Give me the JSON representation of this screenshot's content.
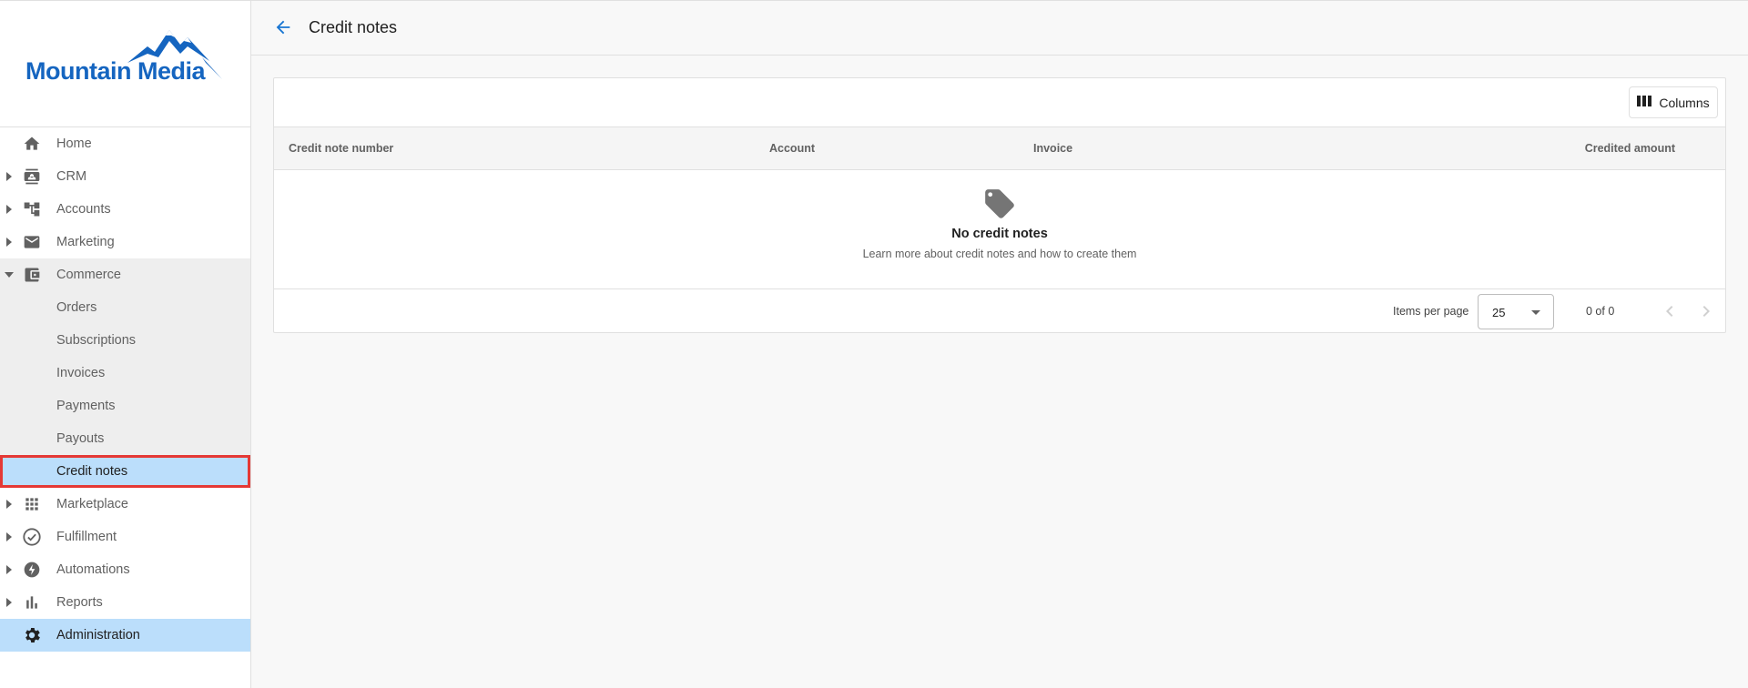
{
  "brand": {
    "name": "Mountain Media",
    "color": "#1565c0"
  },
  "sidebar": {
    "items": [
      {
        "label": "Home",
        "icon": "home-icon"
      },
      {
        "label": "CRM",
        "icon": "contact-card-icon"
      },
      {
        "label": "Accounts",
        "icon": "hierarchy-icon"
      },
      {
        "label": "Marketing",
        "icon": "mail-icon"
      },
      {
        "label": "Commerce",
        "icon": "wallet-icon"
      },
      {
        "label": "Orders"
      },
      {
        "label": "Subscriptions"
      },
      {
        "label": "Invoices"
      },
      {
        "label": "Payments"
      },
      {
        "label": "Payouts"
      },
      {
        "label": "Credit notes"
      },
      {
        "label": "Marketplace",
        "icon": "grid-icon"
      },
      {
        "label": "Fulfillment",
        "icon": "check-circle-icon"
      },
      {
        "label": "Automations",
        "icon": "bolt-icon"
      },
      {
        "label": "Reports",
        "icon": "bar-chart-icon"
      },
      {
        "label": "Administration",
        "icon": "gear-icon"
      }
    ]
  },
  "header": {
    "title": "Credit notes",
    "back_icon": "arrow-left-icon"
  },
  "toolbar": {
    "columns_label": "Columns"
  },
  "table": {
    "columns": [
      "Credit note number",
      "Account",
      "Invoice",
      "Credited amount"
    ]
  },
  "empty_state": {
    "icon": "tag-icon",
    "title": "No credit notes",
    "description": "Learn more about credit notes and how to create them"
  },
  "paginator": {
    "items_per_page_label": "Items per page",
    "items_per_page_value": "25",
    "range_label": "0 of 0"
  },
  "colors": {
    "selected_bg": "#bbdefb",
    "highlight_border": "#e53935",
    "accent": "#1976d2"
  }
}
